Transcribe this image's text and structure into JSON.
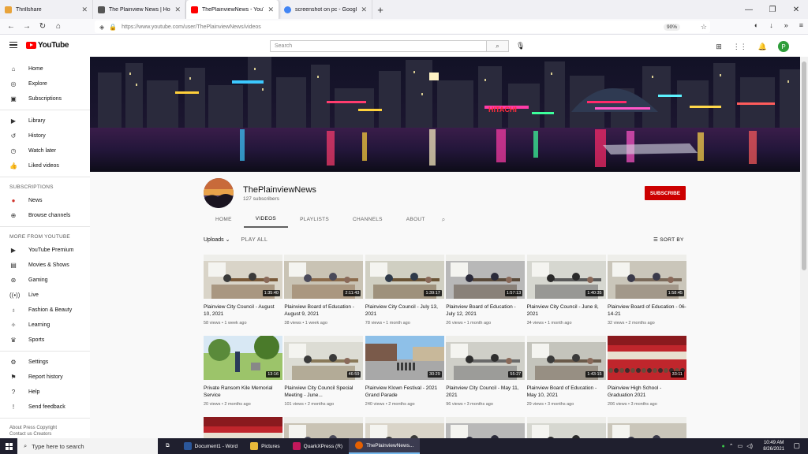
{
  "browser": {
    "tabs": [
      {
        "title": "Thrillshare",
        "color": "#e8a33a"
      },
      {
        "title": "The Plainview News | Home",
        "color": "#555555"
      },
      {
        "title": "ThePlainviewNews - YouTube",
        "color": "#ff0000"
      },
      {
        "title": "screenshot on pc - Google Sear",
        "color": "#4285f4"
      }
    ],
    "url": "https://www.youtube.com/user/ThePlainviewNews/videos",
    "zoom": "90%"
  },
  "youtube": {
    "logo_text": "YouTube",
    "search_placeholder": "Search",
    "avatar_letter": "P"
  },
  "sidebar": {
    "main": [
      {
        "label": "Home",
        "icon": "home-icon",
        "glyph": "⌂"
      },
      {
        "label": "Explore",
        "icon": "compass-icon",
        "glyph": "◎"
      },
      {
        "label": "Subscriptions",
        "icon": "subscriptions-icon",
        "glyph": "▣"
      }
    ],
    "library": [
      {
        "label": "Library",
        "icon": "library-icon",
        "glyph": "▶"
      },
      {
        "label": "History",
        "icon": "history-icon",
        "glyph": "↺"
      },
      {
        "label": "Watch later",
        "icon": "clock-icon",
        "glyph": "◷"
      },
      {
        "label": "Liked videos",
        "icon": "thumbs-up-icon",
        "glyph": "👍"
      }
    ],
    "subscriptions_heading": "SUBSCRIPTIONS",
    "subscriptions": [
      {
        "label": "News",
        "icon": "news-avatar-icon",
        "glyph": "●"
      },
      {
        "label": "Browse channels",
        "icon": "plus-circle-icon",
        "glyph": "⊕"
      }
    ],
    "more_heading": "MORE FROM YOUTUBE",
    "more": [
      {
        "label": "YouTube Premium",
        "icon": "youtube-icon",
        "glyph": "▶"
      },
      {
        "label": "Movies & Shows",
        "icon": "film-icon",
        "glyph": "▤"
      },
      {
        "label": "Gaming",
        "icon": "gamepad-icon",
        "glyph": "⊛"
      },
      {
        "label": "Live",
        "icon": "live-icon",
        "glyph": "((•))"
      },
      {
        "label": "Fashion & Beauty",
        "icon": "hanger-icon",
        "glyph": "♁"
      },
      {
        "label": "Learning",
        "icon": "bulb-icon",
        "glyph": "✧"
      },
      {
        "label": "Sports",
        "icon": "trophy-icon",
        "glyph": "♛"
      }
    ],
    "settings": [
      {
        "label": "Settings",
        "icon": "gear-icon",
        "glyph": "⚙"
      },
      {
        "label": "Report history",
        "icon": "flag-icon",
        "glyph": "⚑"
      },
      {
        "label": "Help",
        "icon": "help-icon",
        "glyph": "?"
      },
      {
        "label": "Send feedback",
        "icon": "feedback-icon",
        "glyph": "!"
      }
    ],
    "footer1": "About  Press  Copyright",
    "footer2": "Contact us  Creators"
  },
  "channel": {
    "name": "ThePlainviewNews",
    "subscribers": "127 subscribers",
    "subscribe_label": "SUBSCRIBE",
    "tabs": [
      "HOME",
      "VIDEOS",
      "PLAYLISTS",
      "CHANNELS",
      "ABOUT"
    ],
    "active_tab": "VIDEOS"
  },
  "videos_section": {
    "uploads_label": "Uploads",
    "play_all": "PLAY ALL",
    "sort_by": "SORT BY",
    "videos": [
      {
        "title": "Plainview City Council - August 10, 2021",
        "meta": "58 views • 1 week ago",
        "duration": "1:35:40",
        "scene": "council"
      },
      {
        "title": "Plainview Board of Education - August 9, 2021",
        "meta": "38 views • 1 week ago",
        "duration": "2:11:43",
        "scene": "library"
      },
      {
        "title": "Plainview City Council - July 13, 2021",
        "meta": "78 views • 1 month ago",
        "duration": "1:39:17",
        "scene": "council2"
      },
      {
        "title": "Plainview Board of Education - July 12, 2021",
        "meta": "26 views • 1 month ago",
        "duration": "1:57:13",
        "scene": "library2"
      },
      {
        "title": "Plainview City Council - June 8, 2021",
        "meta": "34 views • 1 month ago",
        "duration": "1:40:35",
        "scene": "council3"
      },
      {
        "title": "Plainview Board of Education - 06-14-21",
        "meta": "32 views • 2 months ago",
        "duration": "1:58:45",
        "scene": "library3"
      },
      {
        "title": "Private Ransom Kile Memorial Service",
        "meta": "20 views • 2 months ago",
        "duration": "13:16",
        "scene": "outdoor"
      },
      {
        "title": "Plainview City Council Special Meeting - June...",
        "meta": "101 views • 2 months ago",
        "duration": "46:59",
        "scene": "council4"
      },
      {
        "title": "Plainview Klown Festival - 2021 Grand Parade",
        "meta": "240 views • 2 months ago",
        "duration": "30:29",
        "scene": "parade"
      },
      {
        "title": "Plainview City Council - May 11, 2021",
        "meta": "96 views • 3 months ago",
        "duration": "55:27",
        "scene": "council5"
      },
      {
        "title": "Plainview Board of Education - May 10, 2021",
        "meta": "29 views • 3 months ago",
        "duration": "1:43:15",
        "scene": "library4"
      },
      {
        "title": "Plainview High School - Graduation 2021",
        "meta": "206 views • 3 months ago",
        "duration": "33:11",
        "scene": "stage"
      }
    ]
  },
  "taskbar": {
    "search_placeholder": "Type here to search",
    "items": [
      {
        "label": "Document1 - Word",
        "color": "#2b579a"
      },
      {
        "label": "Pictures",
        "color": "#e8b93a"
      },
      {
        "label": "QuarkXPress (R)",
        "color": "#c2185b"
      },
      {
        "label": "ThePlainviewNews...",
        "color": "#e66000"
      }
    ],
    "time": "10:49 AM",
    "date": "8/26/2021"
  }
}
